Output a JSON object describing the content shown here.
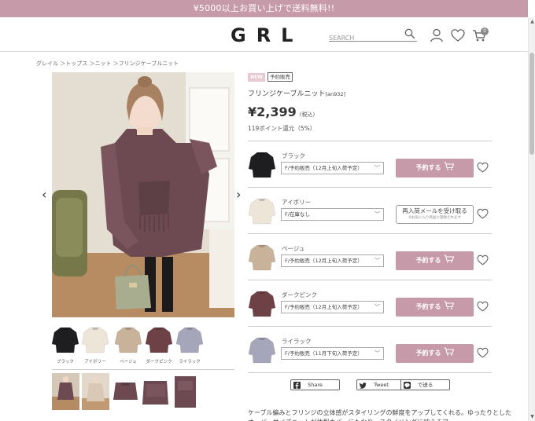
{
  "promo": {
    "text": "¥5000以上お買い上げで送料無料!!"
  },
  "header": {
    "logo": "GRL",
    "search_placeholder": "SEARCH",
    "cart_count": "0",
    "icons": [
      "search-icon",
      "user-icon",
      "heart-icon",
      "cart-icon"
    ]
  },
  "breadcrumb": "グレイル ＞トップス ＞ニット ＞フリンジケーブルニット",
  "gallery": {
    "swatches": [
      {
        "label": "ブラック",
        "color": "#1e1e20"
      },
      {
        "label": "アイボリー",
        "color": "#eee5d9"
      },
      {
        "label": "ベージュ",
        "color": "#c9b29a"
      },
      {
        "label": "ダークピンク",
        "color": "#6e4147"
      },
      {
        "label": "ライラック",
        "color": "#a6a6bb"
      }
    ]
  },
  "product": {
    "badge_new": "NEW",
    "badge_preorder": "予約販売",
    "name": "フリンジケーブルニット",
    "code": "[an932]",
    "price": "¥2,399",
    "tax": "(税込)",
    "points": "119ポイント還元（5%）"
  },
  "variants": [
    {
      "color": "ブラック",
      "option": "F/予約販売（12月上旬入荷予定）",
      "action": "予約する",
      "status": "reserve",
      "swatch": "#1e1e20"
    },
    {
      "color": "アイボリー",
      "option": "F/在庫なし",
      "action": "再入荷メールを受け取る",
      "note": "※お気に入り商品に登録されます",
      "status": "notify",
      "swatch": "#eee5d9"
    },
    {
      "color": "ベージュ",
      "option": "F/予約販売（12月上旬入荷予定）",
      "action": "予約する",
      "status": "reserve",
      "swatch": "#c9b29a"
    },
    {
      "color": "ダークピンク",
      "option": "F/予約販売（12月上旬入荷予定）",
      "action": "予約する",
      "status": "reserve",
      "swatch": "#6e4147"
    },
    {
      "color": "ライラック",
      "option": "F/予約販売（11月下旬入荷予定）",
      "action": "予約する",
      "status": "reserve",
      "swatch": "#a6a6bb"
    }
  ],
  "share": {
    "facebook": "Share",
    "twitter": "Tweet",
    "line": "で送る"
  },
  "description": "ケーブル編みとフリンジの立体感がスタイリングの鮮度をアップしてくれる。ゆったりとしたオーバーサイズニットが体型カバーにもなり、スタイリングに映えるア",
  "colors": {
    "accent": "#c79aa9",
    "new_badge": "#e7c9d2",
    "text": "#444444"
  }
}
